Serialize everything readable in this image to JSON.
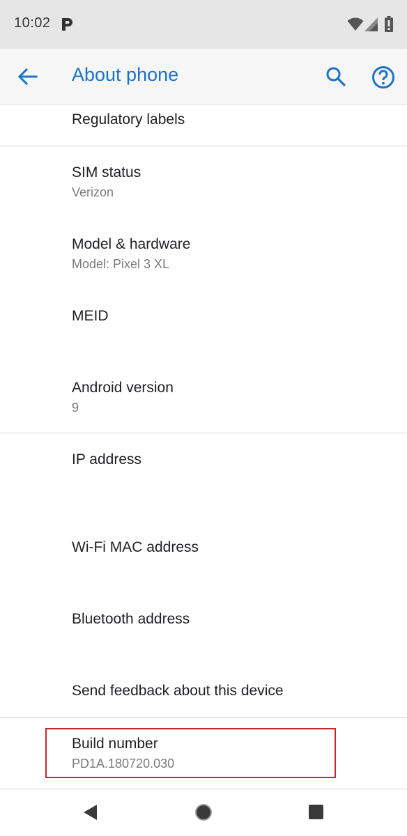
{
  "status_bar": {
    "time": "10:02",
    "icons": [
      "parking-icon",
      "wifi-icon",
      "signal-icon",
      "battery-icon"
    ]
  },
  "app_bar": {
    "title": "About phone",
    "accent_color": "#1a73c8",
    "icons": [
      "back-arrow-icon",
      "search-icon",
      "help-icon"
    ]
  },
  "items": [
    {
      "title": "Regulatory labels",
      "subtitle": ""
    },
    {
      "title": "SIM status",
      "subtitle": "Verizon"
    },
    {
      "title": "Model & hardware",
      "subtitle": "Model: Pixel 3 XL"
    },
    {
      "title": "MEID",
      "subtitle": ""
    },
    {
      "title": "Android version",
      "subtitle": "9"
    },
    {
      "title": "IP address",
      "subtitle": ""
    },
    {
      "title": "Wi-Fi MAC address",
      "subtitle": ""
    },
    {
      "title": "Bluetooth address",
      "subtitle": ""
    },
    {
      "title": "Send feedback about this device",
      "subtitle": ""
    },
    {
      "title": "Build number",
      "subtitle": "PD1A.180720.030"
    }
  ],
  "highlight_color": "#c8262c",
  "nav_bar": {
    "icons": [
      "nav-back-icon",
      "nav-home-icon",
      "nav-recents-icon"
    ]
  }
}
